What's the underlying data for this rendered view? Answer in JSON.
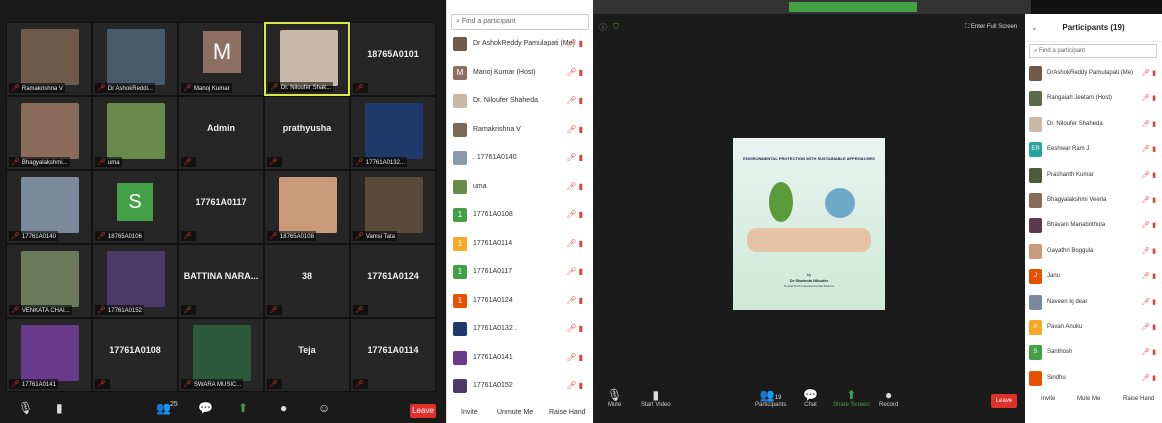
{
  "left_gallery": {
    "tiles": [
      {
        "label": "Ramakrishna V",
        "kind": "photo",
        "color": "#6d5a4a"
      },
      {
        "label": "Dr AshokReddi...",
        "kind": "photo",
        "color": "#4a5a6a"
      },
      {
        "label": "Manoj Kumar",
        "kind": "avatar",
        "avatar": "M"
      },
      {
        "label": "Dr. Niloufer Shak...",
        "kind": "photo",
        "color": "#c9b9a9",
        "active": true
      },
      {
        "label": "",
        "kind": "text",
        "text": "18765A0101"
      },
      {
        "label": "Bhagyalakshmi...",
        "kind": "photo",
        "color": "#8a6a5a"
      },
      {
        "label": "uma",
        "kind": "photo",
        "color": "#6a8a4a"
      },
      {
        "label": "",
        "kind": "text",
        "text": "Admin"
      },
      {
        "label": "",
        "kind": "text",
        "text": "prathyusha"
      },
      {
        "label": "17761A0132...",
        "kind": "photo",
        "color": "#1f3a6a"
      },
      {
        "label": "17761A0140",
        "kind": "photo",
        "color": "#7a8a9a"
      },
      {
        "label": "18765A0106",
        "kind": "avatarS",
        "avatar": "S"
      },
      {
        "label": "",
        "kind": "text",
        "text": "17761A0117"
      },
      {
        "label": "18765A0108",
        "kind": "photo",
        "color": "#c99a7a"
      },
      {
        "label": "Vamsi Tata",
        "kind": "photo",
        "color": "#5a4a3a"
      },
      {
        "label": "VENKATA CHAI...",
        "kind": "photo",
        "color": "#6a7a5a"
      },
      {
        "label": "17761A0152",
        "kind": "photo",
        "color": "#4a3a6a"
      },
      {
        "label": "",
        "kind": "text",
        "text": "BATTINA NARA..."
      },
      {
        "label": "",
        "kind": "text",
        "text": "38"
      },
      {
        "label": "",
        "kind": "text",
        "text": "17761A0124"
      },
      {
        "label": "17761A0141",
        "kind": "photo",
        "color": "#6a3a8a"
      },
      {
        "label": "",
        "kind": "text",
        "text": "17761A0108"
      },
      {
        "label": "SWARA MUSIC...",
        "kind": "photo",
        "color": "#2a5a3a"
      },
      {
        "label": "",
        "kind": "text",
        "text": "Teja"
      },
      {
        "label": "",
        "kind": "text",
        "text": "17761A0114"
      }
    ]
  },
  "left_toolbar": {
    "participant_count": "25",
    "leave": "Leave"
  },
  "left_panel": {
    "search_placeholder": "Find a participant",
    "participants": [
      {
        "name": "Dr AshokReddy Pamulapati (Me)",
        "avatar": "",
        "color": "#6d5a4a"
      },
      {
        "name": "Manoj Kumar (Host)",
        "avatar": "M",
        "color": "#8d6e63"
      },
      {
        "name": "Dr. Niloufer Shaheda",
        "avatar": "",
        "color": "#c9b9a9"
      },
      {
        "name": "Ramakrishna V",
        "avatar": "",
        "color": "#7a6a5a"
      },
      {
        "name": ". 17761A0140",
        "avatar": "",
        "color": "#8a9aaa"
      },
      {
        "name": "uma",
        "avatar": "",
        "color": "#6a8a4a"
      },
      {
        "name": "17761A0108",
        "avatar": "1",
        "color": "#43a047"
      },
      {
        "name": "17761A0114",
        "avatar": "1",
        "color": "#f9a825"
      },
      {
        "name": "17761A0117",
        "avatar": "1",
        "color": "#43a047"
      },
      {
        "name": "17761A0124",
        "avatar": "1",
        "color": "#e65100"
      },
      {
        "name": "17761A0132 .",
        "avatar": "",
        "color": "#1f3a6a"
      },
      {
        "name": "17761A0141",
        "avatar": "",
        "color": "#6a3a8a"
      },
      {
        "name": "17761A0152",
        "avatar": "",
        "color": "#4a3a6a"
      }
    ],
    "buttons": {
      "invite": "Invite",
      "unmute": "Unmute Me",
      "raise": "Raise Hand"
    }
  },
  "right_window": {
    "fullscreen": "Enter Full Screen",
    "slide": {
      "title": "ENVIRONMENTAL PROTECTION WITH SUSTAINABLE APPROACHES",
      "by": "by",
      "author": "Dr Shaheda Niloufer",
      "subtitle": "Sr Asst Prof in Environmental Science"
    },
    "toolbar": {
      "mute": "Mute",
      "video": "Start Video",
      "participants": "Participants",
      "count": "19",
      "chat": "Chat",
      "share": "Share Screen",
      "record": "Record",
      "leave": "Leave"
    },
    "panel": {
      "title": "Participants (19)",
      "search_placeholder": "Find a participant",
      "participants": [
        {
          "name": "DrAshokReddy Pamulapati (Me)",
          "avatar": "",
          "color": "#6d5a4a"
        },
        {
          "name": "Rangaiah Jeetam (Host)",
          "avatar": "",
          "color": "#5a6a4a"
        },
        {
          "name": "Dr. Niloufer Shaheda",
          "avatar": "",
          "color": "#c9b9a9"
        },
        {
          "name": "Eeshwar Ram J",
          "avatar": "ER",
          "color": "#26a69a"
        },
        {
          "name": "Prashanth Kumar",
          "avatar": "",
          "color": "#4a5a3a"
        },
        {
          "name": "Bhagyalakshmi Veerla",
          "avatar": "",
          "color": "#8a6a5a"
        },
        {
          "name": "Bhavani Manabothula",
          "avatar": "",
          "color": "#5a3a4a"
        },
        {
          "name": "Gayathri Boggula",
          "avatar": "",
          "color": "#c99a7a"
        },
        {
          "name": "Janu",
          "avatar": "J",
          "color": "#e65100"
        },
        {
          "name": "Naveen kj dear",
          "avatar": "",
          "color": "#7a8a9a"
        },
        {
          "name": "Pavan Anuku",
          "avatar": "A",
          "color": "#f9a825"
        },
        {
          "name": "Santhosh",
          "avatar": "S",
          "color": "#43a047"
        },
        {
          "name": "Sindhu",
          "avatar": "",
          "color": "#e65100"
        }
      ],
      "buttons": {
        "invite": "Invite",
        "mute": "Mute Me",
        "raise": "Raise Hand"
      }
    }
  }
}
